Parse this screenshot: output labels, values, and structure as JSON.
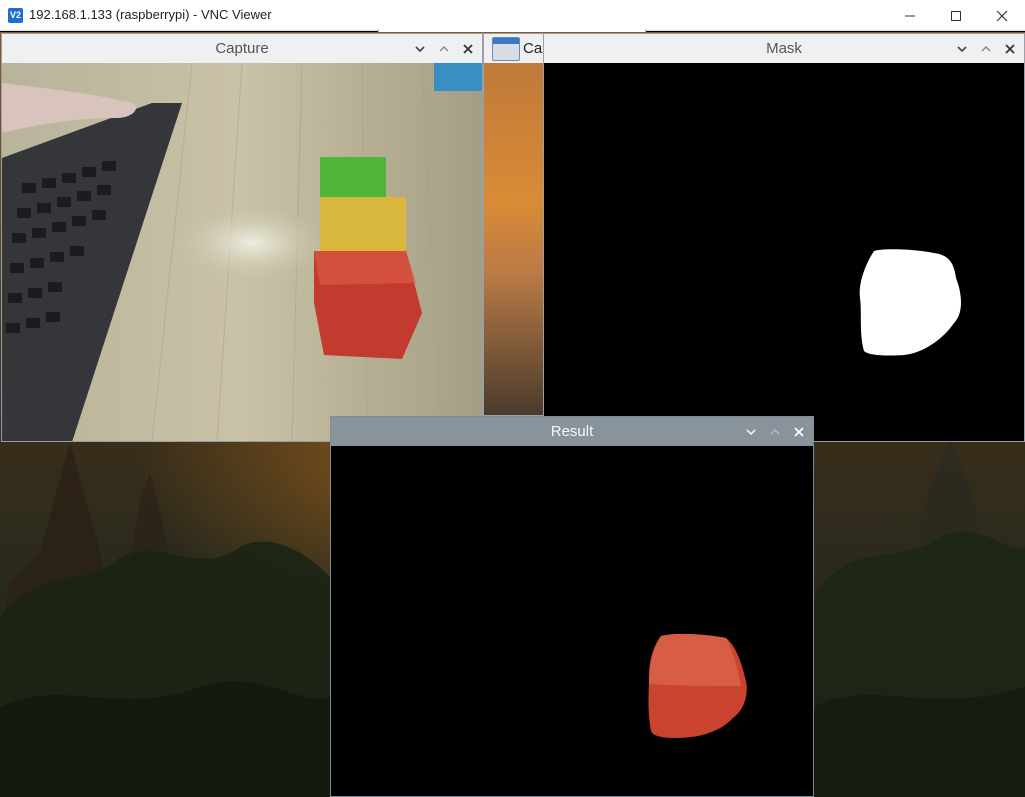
{
  "vnc": {
    "title": "192.168.1.133 (raspberrypi) - VNC Viewer",
    "logo_text": "V2",
    "controls": {
      "minimize_icon": "minimize-icon",
      "maximize_icon": "maximize-icon",
      "close_icon": "close-icon"
    }
  },
  "windows": {
    "capture": {
      "title": "Capture"
    },
    "partial": {
      "label": "Ca"
    },
    "mask": {
      "title": "Mask"
    },
    "result": {
      "title": "Result"
    }
  },
  "window_controls": [
    "chevron-down-icon",
    "chevron-up-icon",
    "close-icon"
  ],
  "colors": {
    "cube_green": "#4fb63a",
    "cube_yellow": "#d9b63c",
    "cube_red": "#c33a2e",
    "active_titlebar": "#89939c",
    "inactive_titlebar": "#eef0f2"
  }
}
